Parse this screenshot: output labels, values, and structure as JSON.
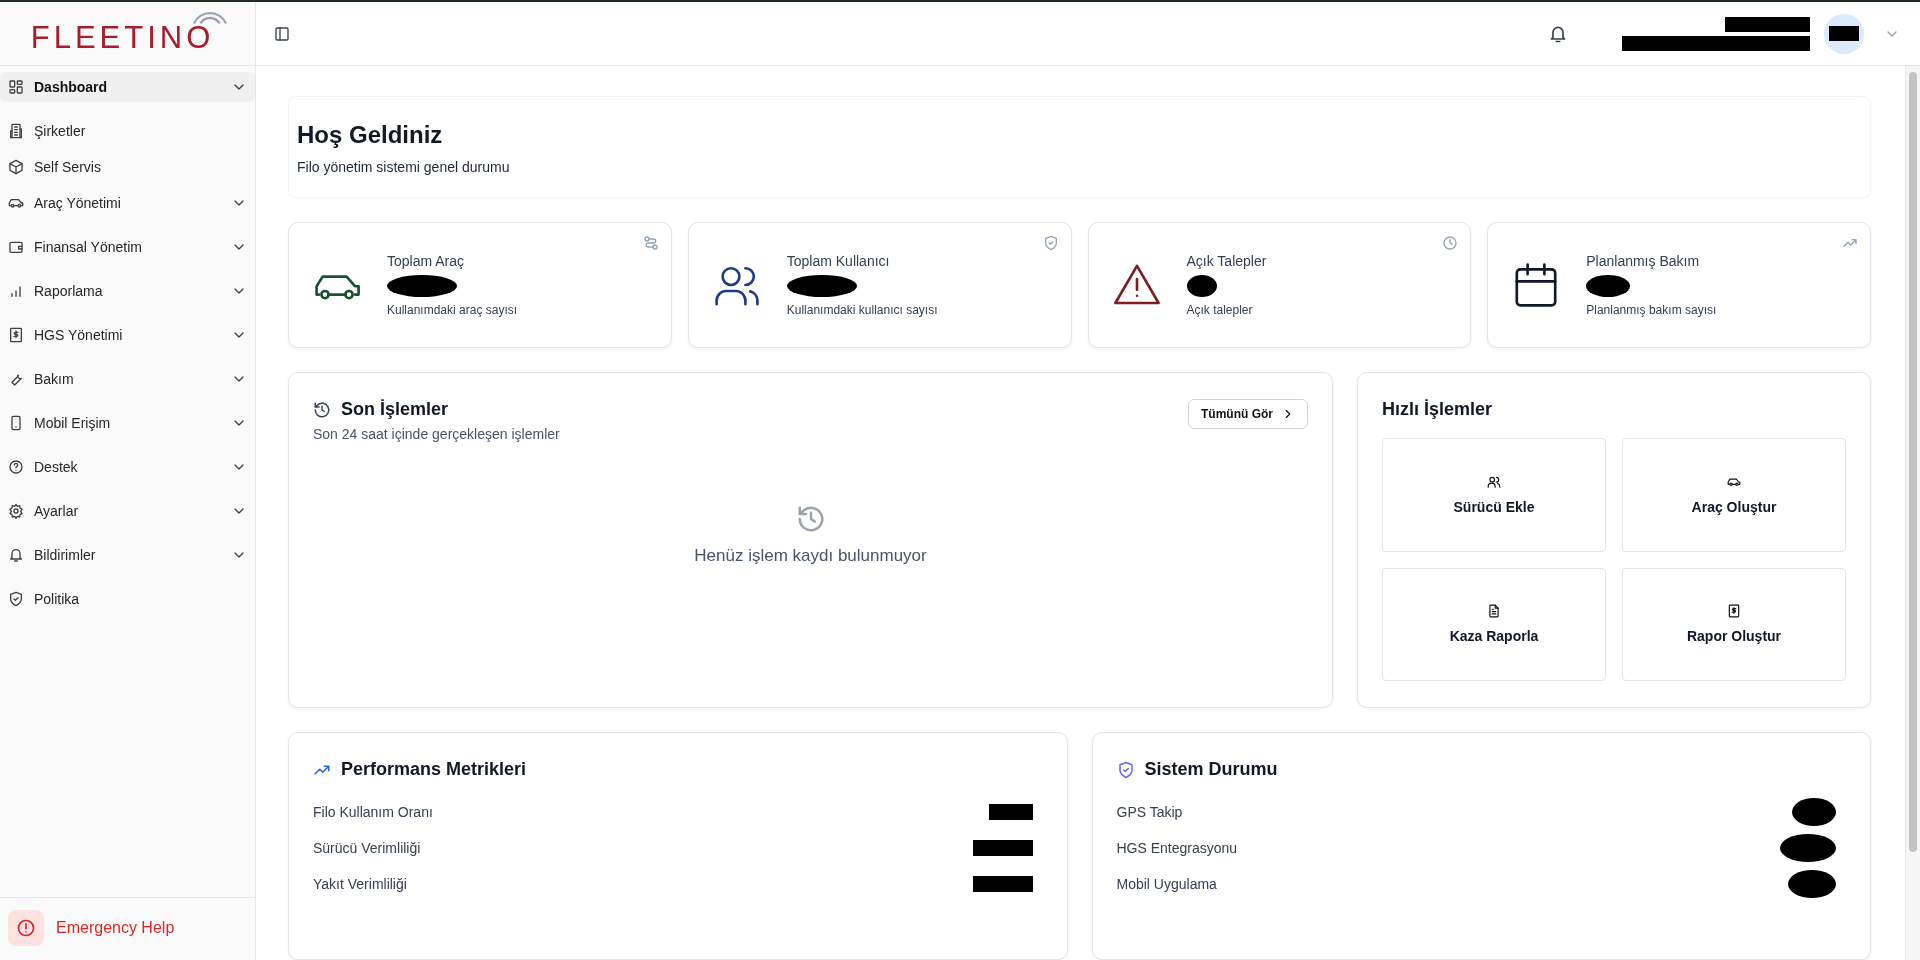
{
  "logo": {
    "text": "FLEETINO"
  },
  "sidebar": {
    "items": [
      {
        "label": "Dashboard",
        "selected": true,
        "expandable": true
      },
      {
        "label": "Şirketler",
        "selected": false,
        "expandable": false
      },
      {
        "label": "Self Servis",
        "selected": false,
        "expandable": false
      },
      {
        "label": "Araç Yönetimi",
        "selected": false,
        "expandable": true
      },
      {
        "label": "Finansal Yönetim",
        "selected": false,
        "expandable": true
      },
      {
        "label": "Raporlama",
        "selected": false,
        "expandable": true
      },
      {
        "label": "HGS Yönetimi",
        "selected": false,
        "expandable": true
      },
      {
        "label": "Bakım",
        "selected": false,
        "expandable": true
      },
      {
        "label": "Mobil Erişim",
        "selected": false,
        "expandable": true
      },
      {
        "label": "Destek",
        "selected": false,
        "expandable": true
      },
      {
        "label": "Ayarlar",
        "selected": false,
        "expandable": true
      },
      {
        "label": "Bildirimler",
        "selected": false,
        "expandable": true
      },
      {
        "label": "Politika",
        "selected": false,
        "expandable": false
      }
    ],
    "emergency": "Emergency Help"
  },
  "welcome": {
    "title": "Hoş Geldiniz",
    "subtitle": "Filo yönetim sistemi genel durumu"
  },
  "stats": [
    {
      "title": "Toplam Araç",
      "caption": "Kullanımdaki araç sayısı",
      "color": "#14532d"
    },
    {
      "title": "Toplam Kullanıcı",
      "caption": "Kullanımdaki kullanıcı sayısı",
      "color": "#1e3a8a"
    },
    {
      "title": "Açık Talepler",
      "caption": "Açık talepler",
      "color": "#7f1d1d"
    },
    {
      "title": "Planlanmış Bakım",
      "caption": "Planlanmış bakım sayısı",
      "color": "#111827"
    }
  ],
  "recent": {
    "title": "Son İşlemler",
    "subtitle": "Son 24 saat içinde gerçekleşen işlemler",
    "button": "Tümünü Gör",
    "empty": "Henüz işlem kaydı bulunmuyor"
  },
  "quick": {
    "title": "Hızlı İşlemler",
    "actions": [
      {
        "label": "Sürücü Ekle"
      },
      {
        "label": "Araç Oluştur"
      },
      {
        "label": "Kaza Raporla"
      },
      {
        "label": "Rapor Oluştur"
      }
    ]
  },
  "performance": {
    "title": "Performans Metrikleri",
    "rows": [
      "Filo Kullanım Oranı",
      "Sürücü Verimliliği",
      "Yakıt Verimliliği"
    ]
  },
  "system": {
    "title": "Sistem Durumu",
    "rows": [
      "GPS Takip",
      "HGS Entegrasyonu",
      "Mobil Uygulama"
    ]
  }
}
